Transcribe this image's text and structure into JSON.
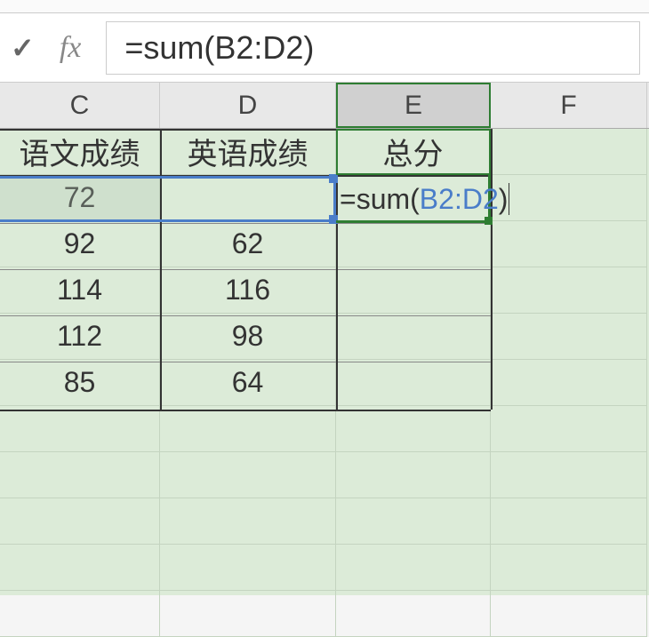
{
  "formula_bar": {
    "check_glyph": "✓",
    "fx_label": "fx",
    "formula": "=sum(B2:D2)"
  },
  "columns": {
    "c": "C",
    "d": "D",
    "e": "E",
    "f": "F"
  },
  "headers": {
    "c": "语文成绩",
    "d": "英语成绩",
    "e": "总分"
  },
  "rows": [
    {
      "c": "72",
      "d": ""
    },
    {
      "c": "92",
      "d": "62"
    },
    {
      "c": "114",
      "d": "116"
    },
    {
      "c": "112",
      "d": "98"
    },
    {
      "c": "85",
      "d": "64"
    }
  ],
  "active_cell": {
    "prefix": "=sum(",
    "ref": "B2:D2",
    "suffix": ")"
  }
}
